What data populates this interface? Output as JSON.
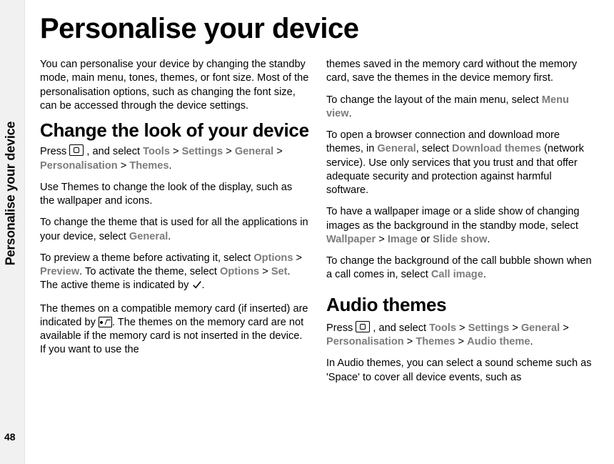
{
  "pageNumber": "48",
  "sideLabel": "Personalise your device",
  "title": "Personalise your device",
  "left": {
    "intro": "You can personalise your device by changing the standby mode, main menu, tones, themes, or font size. Most of the personalisation options, such as changing the font size, can be accessed through the device settings.",
    "h2": "Change the look of your device",
    "press": "Press ",
    "pressAfter": " , and select ",
    "path": {
      "tools": "Tools",
      "settings": "Settings",
      "general": "General",
      "personalisation": "Personalisation",
      "themes": "Themes"
    },
    "sep": " > ",
    "period": ".",
    "p2": "Use Themes to change the look of the display, such as the wallpaper and icons.",
    "p3a": "To change the theme that is used for all the applications in your device, select ",
    "p3General": "General",
    "p4a": "To preview a theme before activating it, select ",
    "p4Options": "Options",
    "p4Preview": "Preview",
    "p4b": ". To activate the theme, select ",
    "p4Set": "Set",
    "p4c": ". The active theme is indicated by ",
    "p5a": "The themes on a compatible memory card (if inserted) are indicated by ",
    "p5b": ". The themes on the memory card are not available if the memory card is not inserted in the device. If you want to use the"
  },
  "right": {
    "p1": "themes saved in the memory card without the memory card, save the themes in the device memory first.",
    "p2a": "To change the layout of the main menu, select ",
    "p2Menu": "Menu view",
    "p3a": "To open a browser connection and download more themes, in ",
    "p3General": "General",
    "p3b": ", select ",
    "p3Download": "Download themes",
    "p3c": " (network service). Use only services that you trust and that offer adequate security and protection against harmful software.",
    "p4a": "To have a wallpaper image or a slide show of changing images as the background in the standby mode, select ",
    "p4Wallpaper": "Wallpaper",
    "p4Image": "Image",
    "p4or": " or ",
    "p4Slide": "Slide show",
    "p5a": "To change the background of the call bubble shown when a call comes in, select ",
    "p5Call": "Call image",
    "h3": "Audio themes",
    "p6Press": "Press ",
    "p6After": " , and select ",
    "p6": {
      "tools": "Tools",
      "settings": "Settings",
      "general": "General",
      "personalisation": "Personalisation",
      "themes": "Themes",
      "audio": "Audio theme"
    },
    "p7": "In Audio themes, you can select a sound scheme such as 'Space' to cover all device events, such as"
  }
}
